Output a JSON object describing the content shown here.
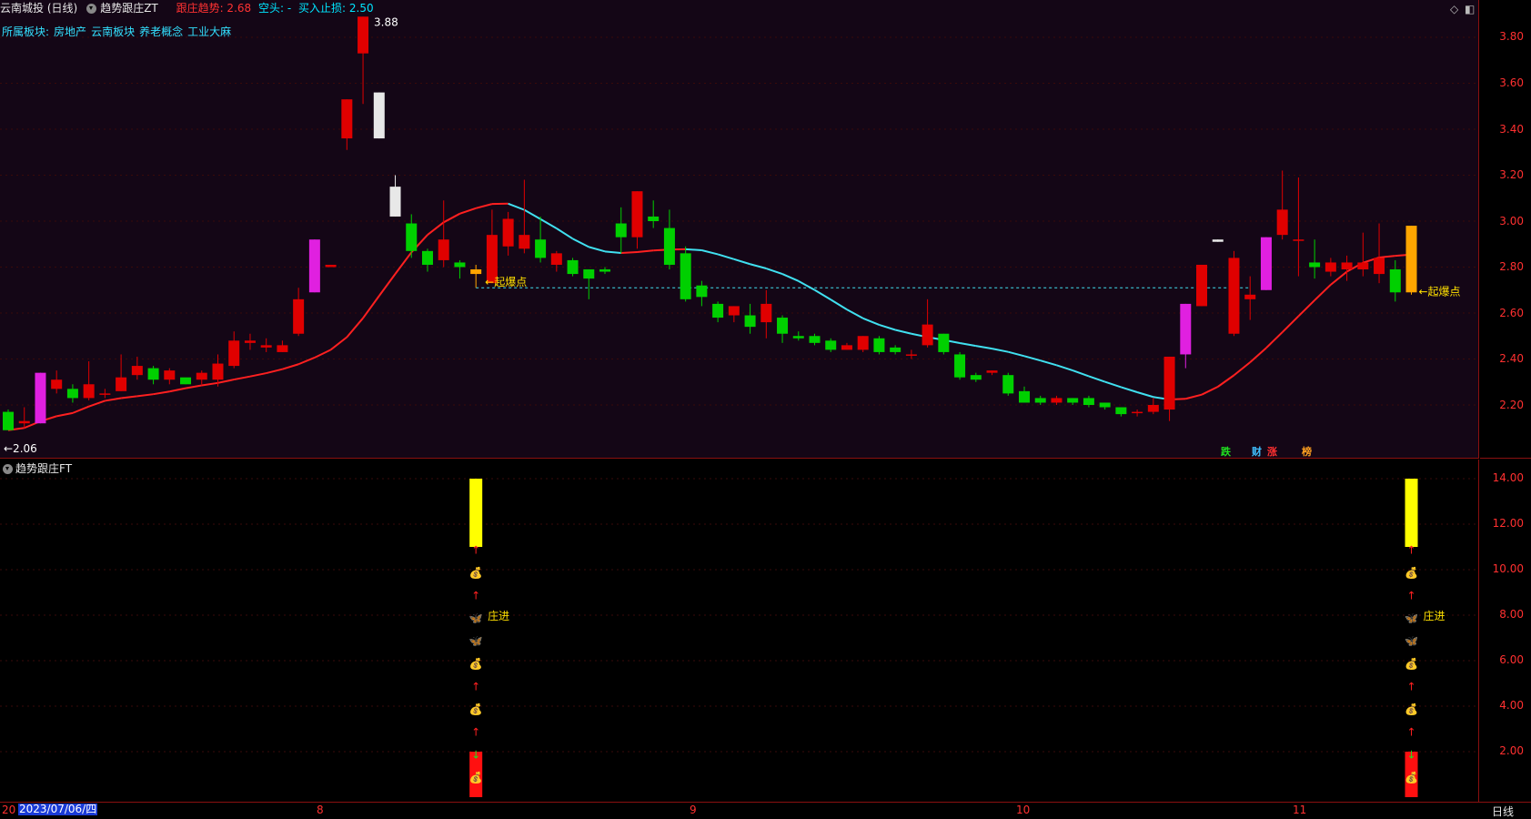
{
  "header": {
    "stock_name": "云南城投 (日线)",
    "indicator_name": "趋势跟庄ZT",
    "trend_label": "跟庄趋势: 2.68",
    "short_label": "空头: -",
    "stop_label": "买入止损: 2.50"
  },
  "sector": {
    "label": "所属板块:",
    "items": [
      "房地产",
      "云南板块",
      "养老概念",
      "工业大麻"
    ]
  },
  "main_chart": {
    "price_ticks": [
      "3.80",
      "3.60",
      "3.40",
      "3.20",
      "3.00",
      "2.80",
      "2.60",
      "2.40",
      "2.20"
    ],
    "high_label": "3.88",
    "low_label": "←2.06",
    "signal_label": "起爆点",
    "event_tags": [
      "跌",
      "财",
      "涨",
      "榜"
    ],
    "colors": {
      "up": "#e00000",
      "down": "#00d000",
      "ma_up": "#ff2020",
      "ma_down": "#40e0f0"
    },
    "candles": [
      [
        2.17,
        2.09,
        2.18,
        2.09
      ],
      [
        2.12,
        2.13,
        2.19,
        2.1
      ],
      [
        2.12,
        2.34,
        2.34,
        2.12
      ],
      [
        2.27,
        2.31,
        2.35,
        2.25
      ],
      [
        2.27,
        2.23,
        2.29,
        2.21
      ],
      [
        2.23,
        2.29,
        2.39,
        2.22
      ],
      [
        2.25,
        2.25,
        2.27,
        2.23
      ],
      [
        2.26,
        2.32,
        2.42,
        2.26
      ],
      [
        2.33,
        2.37,
        2.41,
        2.31
      ],
      [
        2.36,
        2.31,
        2.37,
        2.29
      ],
      [
        2.31,
        2.35,
        2.36,
        2.29
      ],
      [
        2.32,
        2.29,
        2.31,
        2.29
      ],
      [
        2.31,
        2.34,
        2.35,
        2.29
      ],
      [
        2.31,
        2.38,
        2.42,
        2.28
      ],
      [
        2.37,
        2.48,
        2.52,
        2.36
      ],
      [
        2.47,
        2.48,
        2.51,
        2.44
      ],
      [
        2.45,
        2.46,
        2.49,
        2.43
      ],
      [
        2.43,
        2.46,
        2.48,
        2.43
      ],
      [
        2.51,
        2.66,
        2.71,
        2.5
      ],
      [
        2.69,
        2.92,
        2.92,
        2.69
      ],
      [
        2.8,
        2.81,
        2.8,
        2.81
      ],
      [
        3.36,
        3.53,
        3.53,
        3.31
      ],
      [
        3.73,
        3.89,
        3.89,
        3.51
      ],
      [
        3.56,
        3.36,
        3.56,
        3.36
      ],
      [
        3.15,
        3.02,
        3.2,
        3.02
      ],
      [
        2.99,
        2.87,
        3.03,
        2.84
      ],
      [
        2.87,
        2.81,
        2.88,
        2.78
      ],
      [
        2.83,
        2.92,
        3.09,
        2.8
      ],
      [
        2.82,
        2.8,
        2.83,
        2.75
      ],
      [
        2.79,
        2.77,
        2.81,
        2.71
      ],
      [
        2.73,
        2.94,
        3.05,
        2.73
      ],
      [
        2.89,
        3.01,
        3.04,
        2.85
      ],
      [
        2.88,
        2.94,
        3.18,
        2.86
      ],
      [
        2.92,
        2.84,
        3.02,
        2.82
      ],
      [
        2.81,
        2.86,
        2.87,
        2.78
      ],
      [
        2.83,
        2.77,
        2.84,
        2.76
      ],
      [
        2.79,
        2.75,
        2.79,
        2.66
      ],
      [
        2.79,
        2.78,
        2.8,
        2.77
      ],
      [
        2.99,
        2.93,
        3.06,
        2.86
      ],
      [
        2.93,
        3.13,
        3.13,
        2.88
      ],
      [
        3.02,
        3.0,
        3.09,
        2.97
      ],
      [
        2.97,
        2.81,
        3.05,
        2.79
      ],
      [
        2.86,
        2.66,
        2.89,
        2.65
      ],
      [
        2.72,
        2.67,
        2.74,
        2.63
      ],
      [
        2.64,
        2.58,
        2.65,
        2.56
      ],
      [
        2.59,
        2.63,
        2.63,
        2.56
      ],
      [
        2.59,
        2.54,
        2.64,
        2.51
      ],
      [
        2.56,
        2.64,
        2.7,
        2.49
      ],
      [
        2.58,
        2.51,
        2.59,
        2.47
      ],
      [
        2.5,
        2.49,
        2.52,
        2.48
      ],
      [
        2.5,
        2.47,
        2.51,
        2.46
      ],
      [
        2.48,
        2.44,
        2.49,
        2.43
      ],
      [
        2.44,
        2.46,
        2.47,
        2.44
      ],
      [
        2.44,
        2.5,
        2.5,
        2.43
      ],
      [
        2.49,
        2.43,
        2.5,
        2.42
      ],
      [
        2.45,
        2.43,
        2.46,
        2.42
      ],
      [
        2.42,
        2.42,
        2.44,
        2.4
      ],
      [
        2.46,
        2.55,
        2.66,
        2.45
      ],
      [
        2.51,
        2.43,
        2.51,
        2.42
      ],
      [
        2.42,
        2.32,
        2.43,
        2.31
      ],
      [
        2.33,
        2.31,
        2.34,
        2.3
      ],
      [
        2.34,
        2.35,
        2.35,
        2.33
      ],
      [
        2.33,
        2.25,
        2.34,
        2.24
      ],
      [
        2.26,
        2.21,
        2.28,
        2.21
      ],
      [
        2.23,
        2.21,
        2.24,
        2.2
      ],
      [
        2.21,
        2.23,
        2.24,
        2.2
      ],
      [
        2.23,
        2.21,
        2.23,
        2.2
      ],
      [
        2.23,
        2.2,
        2.24,
        2.19
      ],
      [
        2.21,
        2.19,
        2.21,
        2.18
      ],
      [
        2.19,
        2.16,
        2.19,
        2.15
      ],
      [
        2.17,
        2.17,
        2.18,
        2.15
      ],
      [
        2.17,
        2.2,
        2.23,
        2.16
      ],
      [
        2.18,
        2.41,
        2.41,
        2.13
      ],
      [
        2.42,
        2.64,
        2.64,
        2.36
      ],
      [
        2.63,
        2.81,
        2.81,
        2.63
      ],
      [
        2.92,
        2.91,
        2.92,
        2.91
      ],
      [
        2.51,
        2.84,
        2.87,
        2.5
      ],
      [
        2.66,
        2.68,
        2.76,
        2.57
      ],
      [
        2.7,
        2.93,
        2.93,
        2.7
      ],
      [
        2.94,
        3.05,
        3.22,
        2.92
      ],
      [
        2.92,
        2.92,
        3.19,
        2.76
      ],
      [
        2.82,
        2.8,
        2.92,
        2.75
      ],
      [
        2.78,
        2.82,
        2.84,
        2.76
      ],
      [
        2.79,
        2.82,
        2.85,
        2.74
      ],
      [
        2.79,
        2.82,
        2.95,
        2.76
      ],
      [
        2.77,
        2.84,
        2.99,
        2.73
      ],
      [
        2.79,
        2.69,
        2.83,
        2.65
      ],
      [
        2.69,
        2.98,
        2.98,
        2.68
      ]
    ]
  },
  "indicator": {
    "title": "趋势跟庄FT",
    "ticks": [
      "14.00",
      "12.00",
      "10.00",
      "8.00",
      "6.00",
      "4.00",
      "2.00"
    ],
    "zhuang_label": "庄进"
  },
  "footer": {
    "date": "2023/07/06/四",
    "year_prefix": "20",
    "months": [
      "8",
      "9",
      "10",
      "11"
    ],
    "period": "日线"
  }
}
